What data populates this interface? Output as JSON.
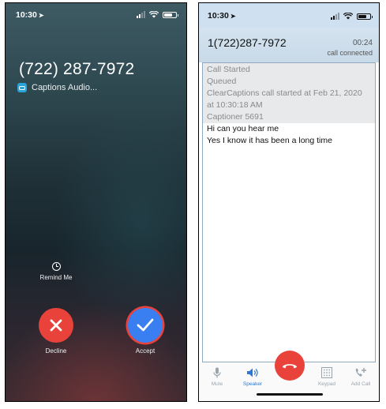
{
  "left_phone": {
    "status": {
      "time": "10:30"
    },
    "caller_number": "(722) 287-7972",
    "app_label": "Captions Audio...",
    "remind_label": "Remind Me",
    "decline_label": "Decline",
    "accept_label": "Accept",
    "colors": {
      "decline": "#e8423a",
      "accept": "#3a7ff2",
      "highlight_ring": "#e8423a"
    },
    "icons": [
      "location-arrow-icon",
      "signal-icon",
      "wifi-icon",
      "battery-icon",
      "captions-app-icon",
      "alarm-clock-icon",
      "x-icon",
      "checkmark-icon"
    ]
  },
  "right_phone": {
    "status": {
      "time": "10:30"
    },
    "header": {
      "number": "1(722)287-7972",
      "duration": "00:24",
      "status": "call connected"
    },
    "transcript": [
      {
        "type": "sys",
        "text": "Call Started"
      },
      {
        "type": "sys",
        "text": "Queued"
      },
      {
        "type": "sys",
        "text": "ClearCaptions call started at Feb 21, 2020 at 10:30:18 AM"
      },
      {
        "type": "sys",
        "text": "Captioner 5691"
      },
      {
        "type": "msg",
        "text": "Hi can you hear me"
      },
      {
        "type": "msg",
        "text": "Yes I know it has been a long time"
      }
    ],
    "toolbar": {
      "mute": "Mute",
      "speaker": "Speaker",
      "keypad": "Keypad",
      "add_call": "Add Call"
    },
    "colors": {
      "end_call": "#e8423a",
      "active": "#2a78d1",
      "header_bg": "#cfe0f0"
    },
    "icons": [
      "microphone-icon",
      "speaker-icon",
      "end-call-icon",
      "keypad-icon",
      "add-call-icon"
    ]
  }
}
